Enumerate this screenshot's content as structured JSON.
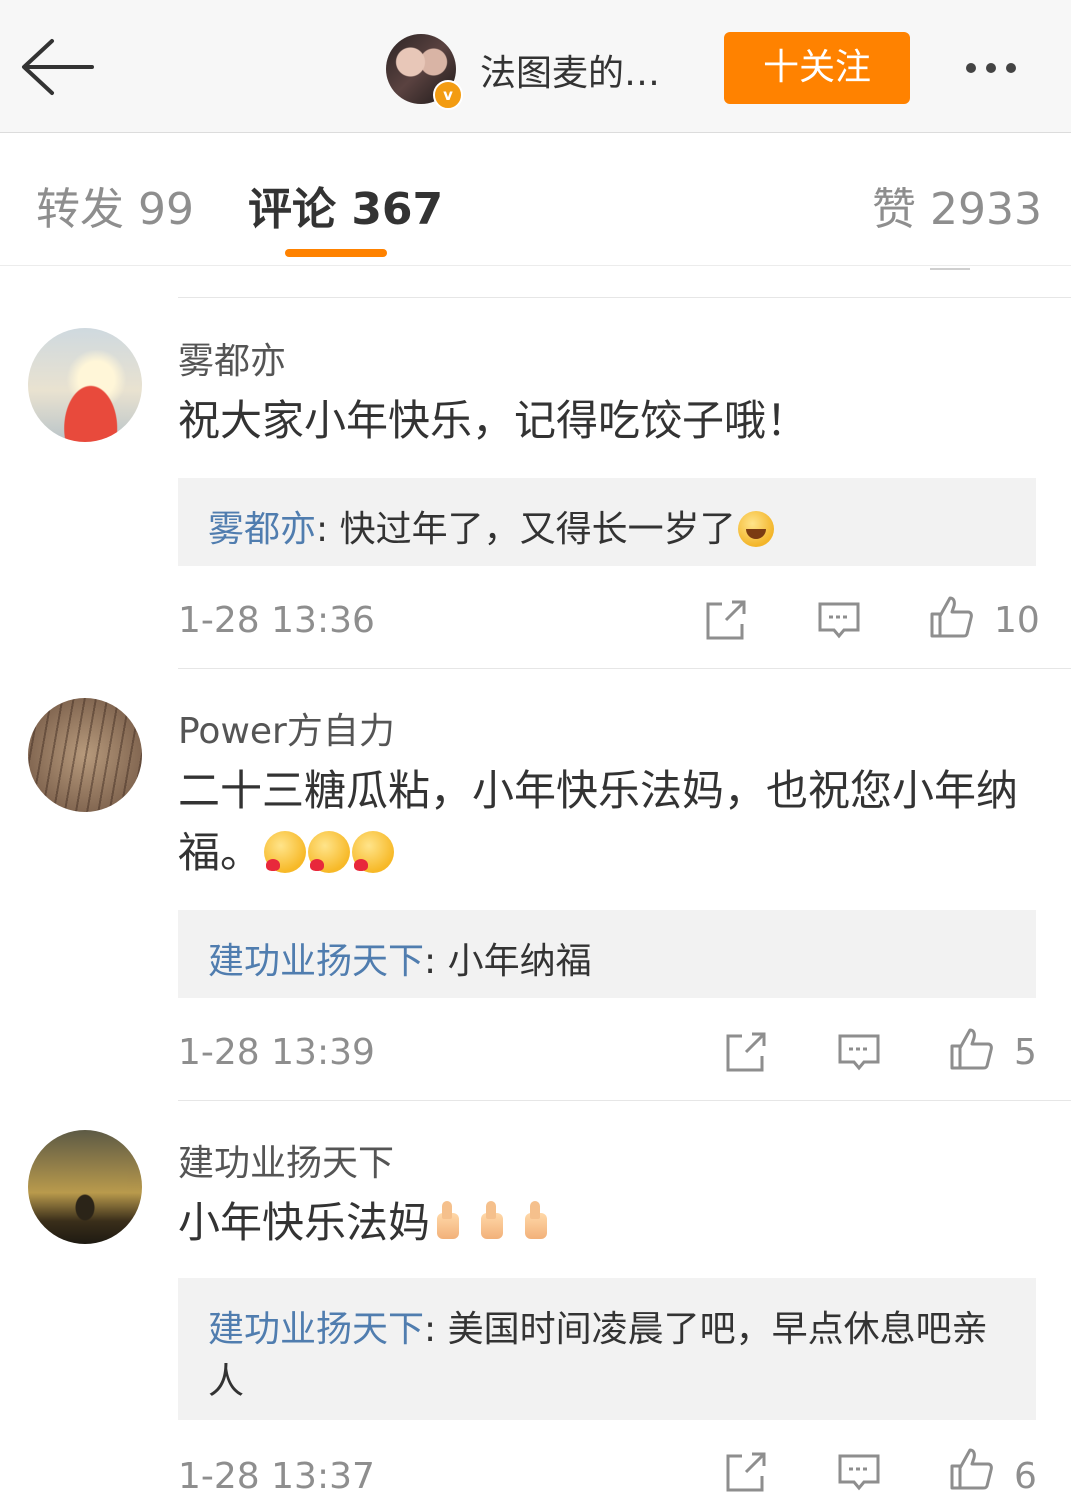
{
  "header": {
    "back_icon": "arrow-left-icon",
    "author_name": "法图麦的…",
    "verified_badge": "v",
    "follow_label": "十关注",
    "more_icon": "more-dots-icon",
    "accent_color": "#ff8200"
  },
  "tabs": [
    {
      "label": "转发 99",
      "active": false
    },
    {
      "label": "评论 367",
      "active": true
    },
    {
      "label": "赞 2933",
      "active": false
    }
  ],
  "comments": [
    {
      "user": "雾都亦",
      "text": "祝大家小年快乐，记得吃饺子哦！",
      "emojis": [],
      "reply": {
        "user": "雾都亦",
        "sep": ": ",
        "text": "快过年了，又得长一岁了",
        "emoji": "laugh-cry-emoji"
      },
      "time": "1-28 13:36",
      "likes": "10"
    },
    {
      "user": "Power方自力",
      "text": "二十三糖瓜粘，小年快乐法妈，也祝您小年纳福。",
      "emojis": [
        "heart-face-emoji",
        "heart-face-emoji",
        "heart-face-emoji"
      ],
      "reply": {
        "user": "建功业扬天下",
        "sep": ": ",
        "text": "小年纳福"
      },
      "time": "1-28 13:39",
      "likes": "5"
    },
    {
      "user": "建功业扬天下",
      "text": "小年快乐法妈",
      "emojis": [
        "thumbs-up-emoji",
        "thumbs-up-emoji",
        "thumbs-up-emoji"
      ],
      "reply": {
        "user": "建功业扬天下",
        "sep": ": ",
        "text": "美国时间凌晨了吧，早点休息吧亲人"
      },
      "time": "1-28 13:37",
      "likes": "6"
    }
  ]
}
